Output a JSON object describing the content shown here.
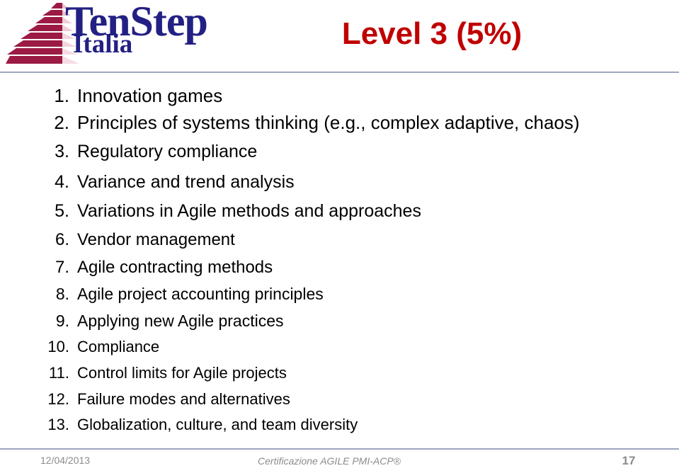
{
  "slide": {
    "title": "Level 3 (5%)",
    "title_color": "#C00000",
    "background_color": "#FFFFFF",
    "rule_color": "#9DA7BE"
  },
  "logo": {
    "brand": "TenStep",
    "sub_brand": "Italia",
    "brand_color": "#232084",
    "pyramid_dark_color": "#9B1B44",
    "pyramid_light_color": "#EFC9D4"
  },
  "list": {
    "items": [
      {
        "number": "1.",
        "text": "Innovation games"
      },
      {
        "number": "2.",
        "text": "Principles of systems thinking (e.g., complex adaptive, chaos)"
      },
      {
        "number": "3.",
        "text": "Regulatory compliance"
      },
      {
        "number": "4.",
        "text": "Variance and trend analysis"
      },
      {
        "number": "5.",
        "text": "Variations in Agile methods and approaches"
      },
      {
        "number": "6.",
        "text": "Vendor management"
      },
      {
        "number": "7.",
        "text": "Agile contracting methods"
      },
      {
        "number": "8.",
        "text": "Agile project accounting principles"
      },
      {
        "number": "9.",
        "text": "Applying new Agile practices"
      },
      {
        "number": "10.",
        "text": "Compliance"
      },
      {
        "number": "11.",
        "text": "Control limits for Agile projects"
      },
      {
        "number": "12.",
        "text": "Failure modes and alternatives"
      },
      {
        "number": "13.",
        "text": "Globalization, culture, and team diversity"
      }
    ]
  },
  "footer": {
    "date": "12/04/2013",
    "center_text": "Certificazione AGILE PMI-ACP®",
    "page_number": "17",
    "text_color": "#8C8C8C"
  }
}
